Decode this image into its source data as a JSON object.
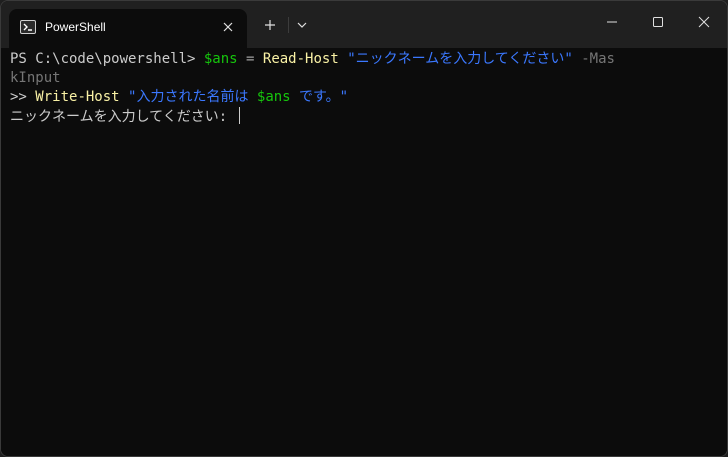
{
  "tab": {
    "title": "PowerShell",
    "icon": "powershell-icon"
  },
  "titlebar": {
    "new_tab_icon": "plus-icon",
    "dropdown_icon": "chevron-down-icon",
    "minimize_icon": "minimize-icon",
    "maximize_icon": "maximize-icon",
    "close_icon": "close-icon"
  },
  "terminal": {
    "line1": {
      "prompt": "PS C:\\code\\powershell> ",
      "var": "$ans",
      "op": " = ",
      "cmd": "Read-Host",
      "space": " ",
      "str": "\"ニックネームを入力してください\"",
      "param": " -Mas"
    },
    "line2": {
      "param": "kInput"
    },
    "line3": {
      "prompt": ">> ",
      "cmd": "Write-Host",
      "space": " ",
      "str_a": "\"入力された名前は ",
      "var": "$ans",
      "str_b": " です。\""
    },
    "line4": {
      "text": "ニックネームを入力してください: "
    }
  },
  "colors": {
    "background": "#0c0c0c",
    "titlebar": "#202020",
    "variable": "#16c60c",
    "command": "#f9f1a5",
    "string": "#3b78ff",
    "parameter": "#767676",
    "foreground": "#cccccc"
  }
}
